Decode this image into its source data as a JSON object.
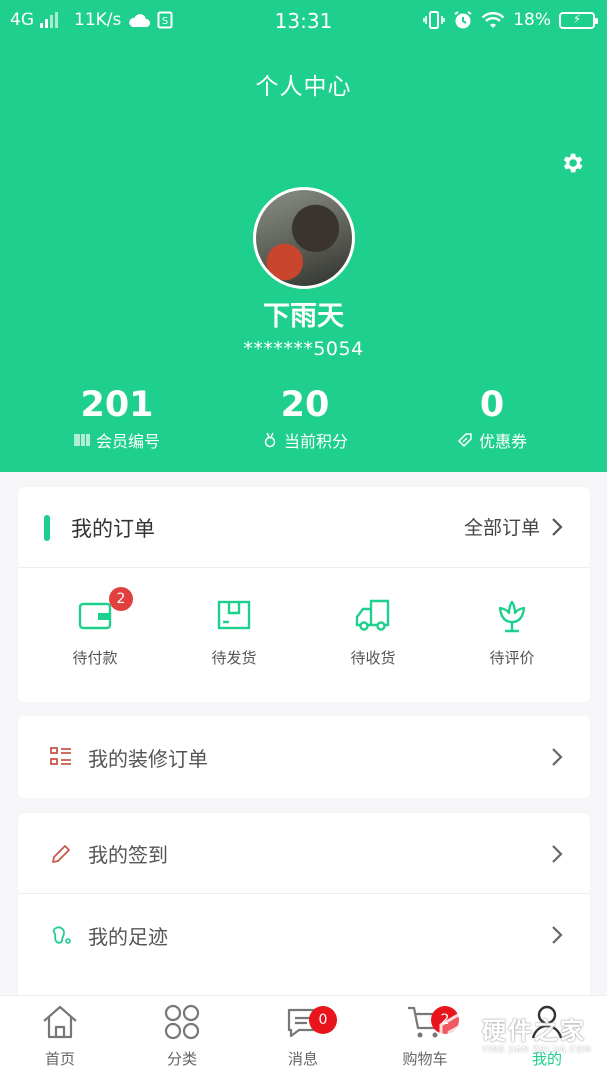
{
  "status_bar": {
    "network": "4G",
    "speed": "11K/s",
    "time": "13:31",
    "battery": "18%"
  },
  "header": {
    "title": "个人中心"
  },
  "profile": {
    "username": "下雨天",
    "phone_masked": "*******5054"
  },
  "stats": [
    {
      "value": "201",
      "label": "会员编号",
      "icon": "barcode-icon"
    },
    {
      "value": "20",
      "label": "当前积分",
      "icon": "medal-icon"
    },
    {
      "value": "0",
      "label": "优惠券",
      "icon": "ticket-icon"
    }
  ],
  "orders": {
    "title": "我的订单",
    "all_label": "全部订单",
    "items": [
      {
        "label": "待付款",
        "badge": "2",
        "icon": "wallet-icon"
      },
      {
        "label": "待发货",
        "icon": "package-icon"
      },
      {
        "label": "待收货",
        "icon": "truck-icon"
      },
      {
        "label": "待评价",
        "icon": "flower-icon"
      }
    ]
  },
  "menu": [
    {
      "label": "我的装修订单",
      "icon": "list-icon"
    },
    {
      "label": "我的签到",
      "icon": "pencil-icon"
    },
    {
      "label": "我的足迹",
      "icon": "footprint-icon"
    }
  ],
  "tabbar": {
    "tabs": [
      {
        "label": "首页",
        "icon": "home-icon"
      },
      {
        "label": "分类",
        "icon": "category-icon"
      },
      {
        "label": "消息",
        "icon": "message-icon",
        "badge": "0"
      },
      {
        "label": "购物车",
        "icon": "cart-icon",
        "badge": "2"
      },
      {
        "label": "我的",
        "icon": "user-icon",
        "active": true
      }
    ]
  },
  "watermark": {
    "text": "硬件之家",
    "sub": "YING JIAN ZHI JIA.COM"
  },
  "colors": {
    "primary": "#1ecf8d",
    "badge": "#e23f3f",
    "menu_icon_red": "#c9574a",
    "menu_icon_green": "#1ecf8d"
  }
}
